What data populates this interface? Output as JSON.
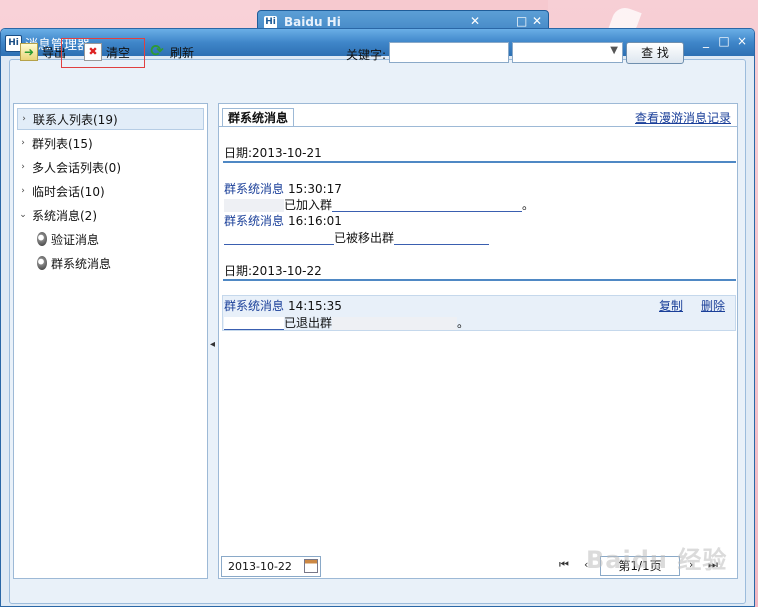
{
  "background_window": {
    "title": "Baidu Hi"
  },
  "window": {
    "title": "消息管理器",
    "controls": [
      "_",
      "□",
      "×"
    ]
  },
  "toolbar": {
    "export_label": "导出",
    "clear_label": "清空",
    "refresh_label": "刷新"
  },
  "search": {
    "keyword_label": "关键字:",
    "keyword_value": "",
    "select_value": "",
    "search_button": "查 找"
  },
  "tree": {
    "items": [
      {
        "label": "联系人列表(19)",
        "caret": "›",
        "selected": true
      },
      {
        "label": "群列表(15)",
        "caret": "›"
      },
      {
        "label": "多人会话列表(0)",
        "caret": "›"
      },
      {
        "label": "临时会话(10)",
        "caret": "›"
      },
      {
        "label": "系统消息(2)",
        "caret": "⌄"
      }
    ],
    "sub_items": [
      {
        "label": "验证消息"
      },
      {
        "label": "群系统消息"
      }
    ]
  },
  "panel": {
    "tab_label": "群系统消息",
    "roam_link": "查看漫游消息记录",
    "groups": [
      {
        "date_label": "日期:2013-10-21",
        "messages": [
          {
            "sender": "群系统消息",
            "time": "15:30:17",
            "text_a": "已加入群",
            "text_b": "。"
          },
          {
            "sender": "群系统消息",
            "time": "16:16:01",
            "text_a": "已被移出群"
          }
        ]
      },
      {
        "date_label": "日期:2013-10-22",
        "messages": [
          {
            "sender": "群系统消息",
            "time": "14:15:35",
            "text_a": "已退出群",
            "text_b": "。"
          }
        ]
      }
    ],
    "copy_label": "复制",
    "delete_label": "删除"
  },
  "bottom": {
    "date_value": "2013-10-22",
    "page_label": "第1/1页",
    "nav_first": "⏮",
    "nav_prev": "‹",
    "nav_next": "›",
    "nav_last": "⏭"
  },
  "watermark": "Baidu 经验"
}
